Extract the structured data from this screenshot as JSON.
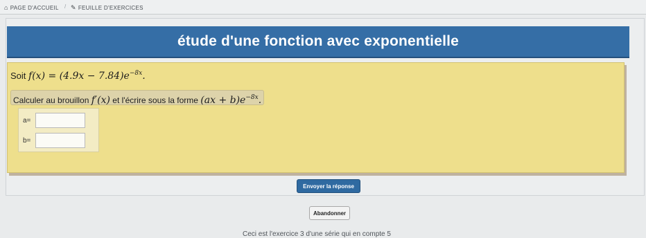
{
  "breadcrumb": {
    "home_label": "PAGE D'ACCUEIL",
    "separator": "/",
    "sheet_label": "FEUILLE D'EXERCICES"
  },
  "exercise": {
    "title": "étude d'une fonction avec exponentielle",
    "statement_prefix": "Soit",
    "function_def": "f(x) = (4.9x − 7.84)e",
    "function_exponent": "−8x",
    "task_prefix": "Calculer au brouillon",
    "task_derivative": "f′(x)",
    "task_middle": "et l'écrire sous la forme",
    "task_form": "(ax + b)e",
    "task_form_exponent": "−8x",
    "answers": [
      {
        "label": "a=",
        "value": ""
      },
      {
        "label": "b=",
        "value": ""
      }
    ]
  },
  "buttons": {
    "submit": "Envoyer la réponse",
    "abandon": "Abandonner"
  },
  "footer": {
    "partial_text": "Ceci est l'exercice 3 d'une série qui en compte 5"
  },
  "colors": {
    "title_bar": "#356ea6",
    "question_bg": "#eedf8c",
    "submit_bg": "#2f6aa1"
  },
  "icons": {
    "home": "home-icon",
    "sheet": "edit-icon"
  }
}
